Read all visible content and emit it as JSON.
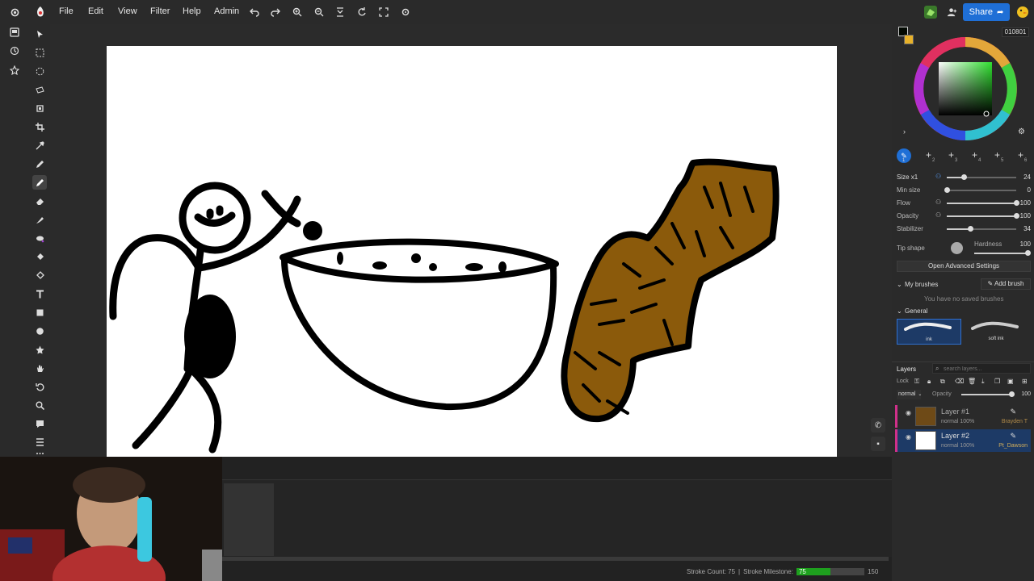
{
  "menu": {
    "items": [
      "File",
      "Edit",
      "View",
      "Filter",
      "Help",
      "Admin"
    ],
    "share_label": "Share"
  },
  "canvas": {
    "bg_color": "#ffffff"
  },
  "color": {
    "hex": "010801",
    "primary": "#010801",
    "secondary": "#e8b22a"
  },
  "brush": {
    "slots": [
      "1",
      "2",
      "3",
      "4",
      "5",
      "6"
    ],
    "size": {
      "label": "Size x1",
      "value": "24",
      "level": 0.24
    },
    "min_size": {
      "label": "Min size",
      "value": "0",
      "level": 0.0
    },
    "flow": {
      "label": "Flow",
      "value": "100",
      "level": 1.0
    },
    "opacity": {
      "label": "Opacity",
      "value": "100",
      "level": 1.0
    },
    "stabilizer": {
      "label": "Stabilizer",
      "value": "34",
      "level": 0.34
    },
    "tip_shape_label": "Tip shape",
    "hardness": {
      "label": "Hardness",
      "value": "100",
      "level": 1.0
    },
    "advanced_label": "Open Advanced Settings"
  },
  "brushes": {
    "my_brushes_label": "My brushes",
    "add_brush_label": "Add brush",
    "empty_text": "You have no saved brushes",
    "general_label": "General",
    "presets": [
      {
        "name": "ink"
      },
      {
        "name": "soft ink"
      }
    ]
  },
  "layers": {
    "title": "Layers",
    "search_placeholder": "search layers...",
    "lock_label": "Lock",
    "blend_mode": "normal",
    "opacity_label": "Opacity",
    "opacity_value": "100",
    "items": [
      {
        "name": "Layer #1",
        "meta": "normal 100%",
        "owner": "Brayden T",
        "selected": false
      },
      {
        "name": "Layer #2",
        "meta": "normal 100%",
        "owner": "Pt_Dawson",
        "selected": true
      }
    ]
  },
  "status": {
    "stroke_count_label": "Stroke Count: 75",
    "milestone_label": "Stroke Milestone:",
    "milestone_value": "75",
    "milestone_max": "150",
    "milestone_fraction": 0.5
  }
}
